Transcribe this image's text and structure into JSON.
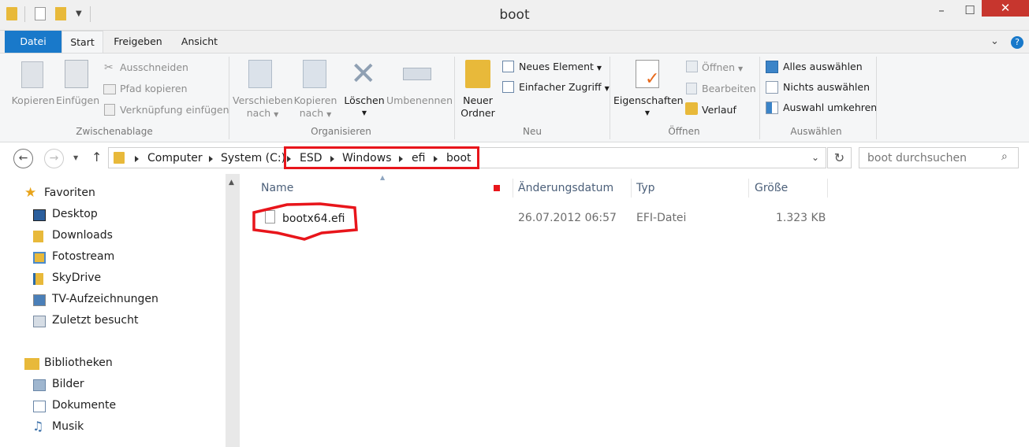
{
  "window": {
    "title": "boot",
    "minimize": "–",
    "maximize": "☐",
    "close": "✕"
  },
  "tabs": {
    "file": "Datei",
    "start": "Start",
    "share": "Freigeben",
    "view": "Ansicht"
  },
  "ribbon": {
    "clipboard": {
      "copy": "Kopieren",
      "paste": "Einfügen",
      "cut": "Ausschneiden",
      "copy_path": "Pfad kopieren",
      "paste_link": "Verknüpfung einfügen",
      "label": "Zwischenablage"
    },
    "organize": {
      "move_to_1": "Verschieben",
      "move_to_2": "nach",
      "copy_to_1": "Kopieren",
      "copy_to_2": "nach",
      "delete": "Löschen",
      "rename": "Umbenennen",
      "label": "Organisieren"
    },
    "new": {
      "new_folder_1": "Neuer",
      "new_folder_2": "Ordner",
      "new_item": "Neues Element",
      "easy_access": "Einfacher Zugriff",
      "label": "Neu"
    },
    "open": {
      "properties": "Eigenschaften",
      "open": "Öffnen",
      "edit": "Bearbeiten",
      "history": "Verlauf",
      "label": "Öffnen"
    },
    "select": {
      "select_all": "Alles auswählen",
      "select_none": "Nichts auswählen",
      "invert": "Auswahl umkehren",
      "label": "Auswählen"
    }
  },
  "address": {
    "crumbs": [
      "Computer",
      "System (C:)",
      "ESD",
      "Windows",
      "efi",
      "boot"
    ],
    "search_placeholder": "boot durchsuchen"
  },
  "nav": {
    "favorites": "Favoriten",
    "fav_items": [
      "Desktop",
      "Downloads",
      "Fotostream",
      "SkyDrive",
      "TV-Aufzeichnungen",
      "Zuletzt besucht"
    ],
    "libraries": "Bibliotheken",
    "lib_items": [
      "Bilder",
      "Dokumente",
      "Musik"
    ]
  },
  "columns": {
    "name": "Name",
    "date": "Änderungsdatum",
    "type": "Typ",
    "size": "Größe"
  },
  "files": [
    {
      "name": "bootx64.efi",
      "date": "26.07.2012 06:57",
      "type": "EFI-Datei",
      "size": "1.323 KB"
    }
  ],
  "colors": {
    "accent": "#1979ca",
    "highlight": "#e8151b",
    "folder": "#e8b93a"
  }
}
